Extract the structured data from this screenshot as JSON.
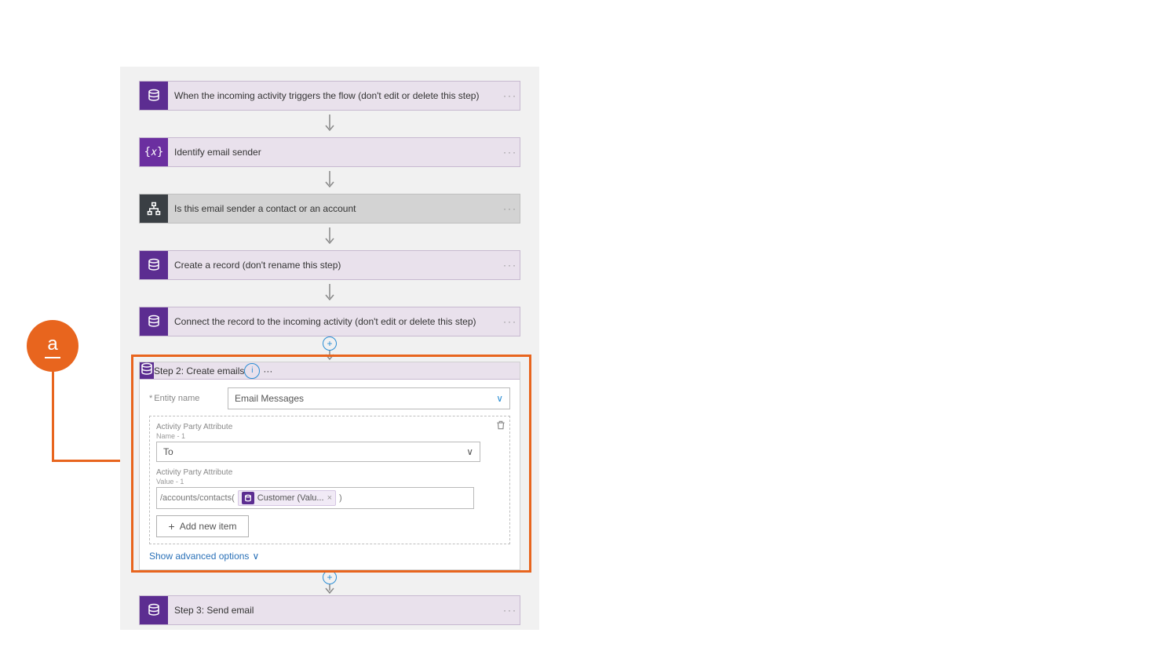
{
  "callout": {
    "letter": "a"
  },
  "steps": {
    "s1": "When the incoming activity triggers the flow (don't edit or delete this step)",
    "s2": "Identify email sender",
    "s3": "Is this email sender a contact or an account",
    "s4": "Create a record (don't rename this step)",
    "s5": "Connect the record to the incoming activity (don't edit or delete this step)",
    "s6": "Step 2: Create emails",
    "s7": "Step 3: Send email"
  },
  "card": {
    "entity_label": "Entity name",
    "entity_value": "Email Messages",
    "apa_name_label": "Activity Party Attribute",
    "apa_name_sub": "Name - 1",
    "apa_name_value": "To",
    "apa_value_label": "Activity Party Attribute",
    "apa_value_sub": "Value - 1",
    "apa_value_prefix": "/accounts/contacts(",
    "apa_value_suffix": ")",
    "token": "Customer (Valu...",
    "add_item": "Add new item",
    "advanced": "Show advanced options"
  },
  "glyphs": {
    "dots": "···",
    "chevron": "∨",
    "plus": "+",
    "close": "×",
    "info": "i"
  }
}
